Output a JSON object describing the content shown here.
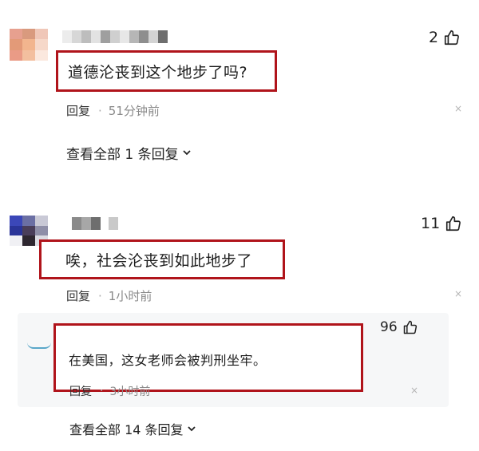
{
  "comments": [
    {
      "likes": "2",
      "text": "道德沦丧到这个地步了吗?",
      "reply_label": "回复",
      "dot": "·",
      "time": "51分钟前",
      "close": "×",
      "view_all": "查看全部 1 条回复"
    },
    {
      "likes": "11",
      "text": "唉，社会沦丧到如此地步了",
      "reply_label": "回复",
      "dot": "·",
      "time": "1小时前",
      "close": "×"
    }
  ],
  "sub_reply": {
    "likes": "96",
    "text": "在美国，这女老师会被判刑坐牢。",
    "reply_label": "回复",
    "dot": "·",
    "time": "3小时前",
    "close": "×",
    "view_all": "查看全部 14 条回复"
  },
  "colors": {
    "highlight_border": "#b0141b",
    "muted_text": "#8a8a8a"
  }
}
